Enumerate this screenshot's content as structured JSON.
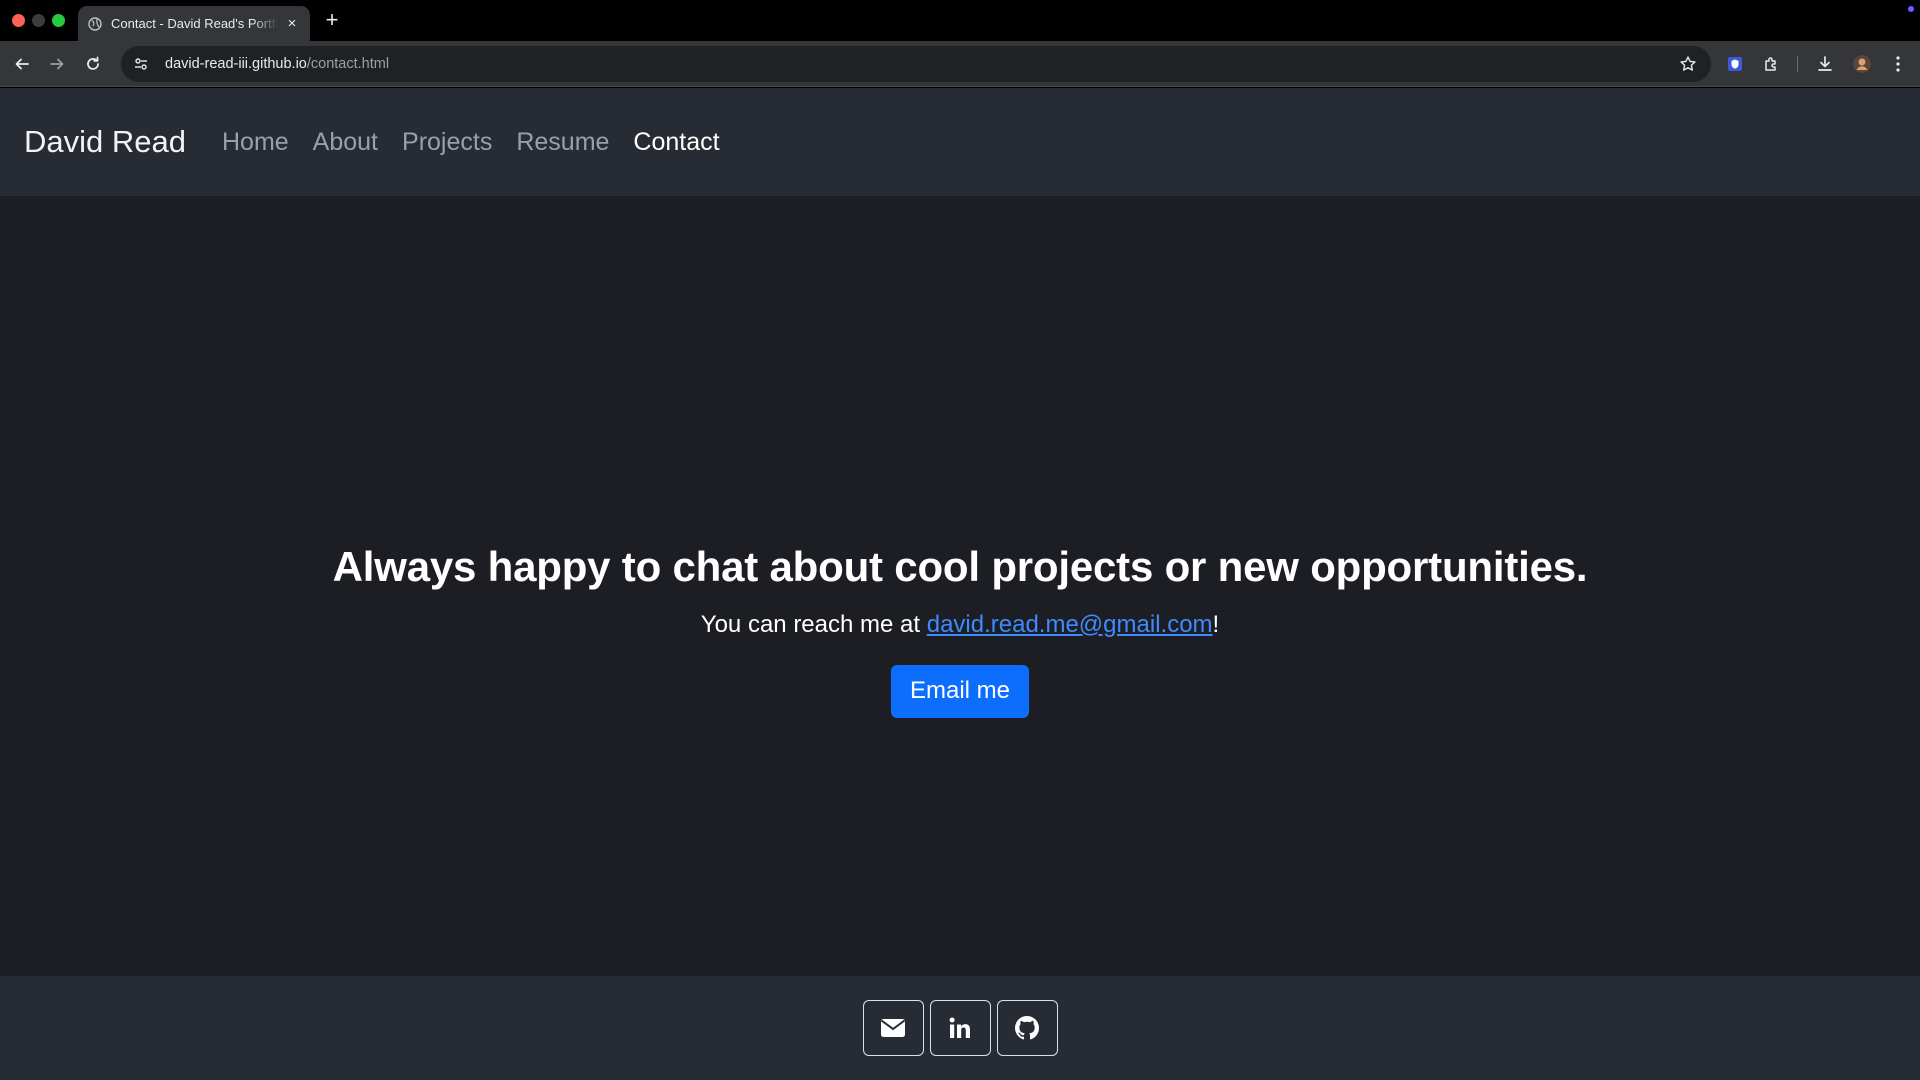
{
  "browser": {
    "tab_title": "Contact - David Read's Portfolio",
    "tab_close": "×",
    "new_tab": "+",
    "url_host": "david-read-iii.github.io",
    "url_path": "/contact.html"
  },
  "site": {
    "brand": "David Read",
    "nav": [
      {
        "label": "Home",
        "active": false
      },
      {
        "label": "About",
        "active": false
      },
      {
        "label": "Projects",
        "active": false
      },
      {
        "label": "Resume",
        "active": false
      },
      {
        "label": "Contact",
        "active": true
      }
    ]
  },
  "hero": {
    "heading": "Always happy to chat about cool projects or new opportunities.",
    "reach_prefix": "You can reach me at ",
    "email": "david.read.me@gmail.com",
    "reach_suffix": "!",
    "button_label": "Email me"
  },
  "footer": {
    "icons": [
      "envelope-icon",
      "linkedin-icon",
      "github-icon"
    ]
  },
  "colors": {
    "page_bg": "#1c1e24",
    "navbar_bg": "#272b33",
    "primary": "#0d6efd",
    "link": "#3d8bfd"
  }
}
